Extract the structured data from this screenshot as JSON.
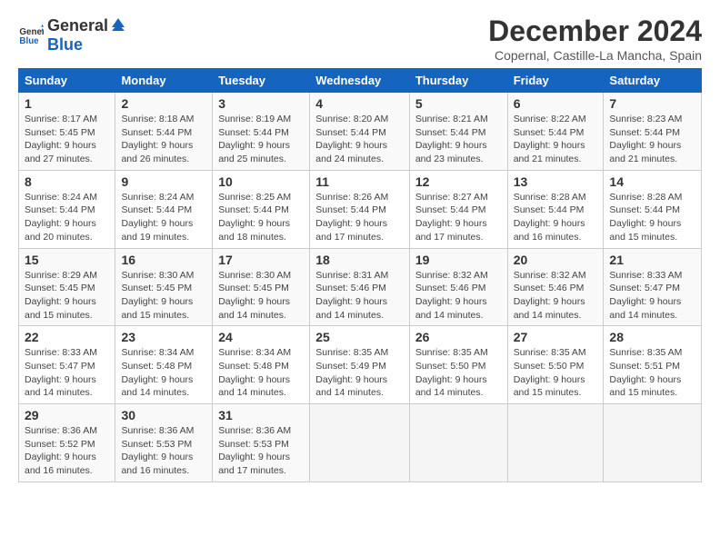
{
  "header": {
    "logo_general": "General",
    "logo_blue": "Blue",
    "title": "December 2024",
    "location": "Copernal, Castille-La Mancha, Spain"
  },
  "calendar": {
    "days_of_week": [
      "Sunday",
      "Monday",
      "Tuesday",
      "Wednesday",
      "Thursday",
      "Friday",
      "Saturday"
    ],
    "weeks": [
      [
        {
          "day": "",
          "info": ""
        },
        {
          "day": "2",
          "info": "Sunrise: 8:18 AM\nSunset: 5:44 PM\nDaylight: 9 hours\nand 26 minutes."
        },
        {
          "day": "3",
          "info": "Sunrise: 8:19 AM\nSunset: 5:44 PM\nDaylight: 9 hours\nand 25 minutes."
        },
        {
          "day": "4",
          "info": "Sunrise: 8:20 AM\nSunset: 5:44 PM\nDaylight: 9 hours\nand 24 minutes."
        },
        {
          "day": "5",
          "info": "Sunrise: 8:21 AM\nSunset: 5:44 PM\nDaylight: 9 hours\nand 23 minutes."
        },
        {
          "day": "6",
          "info": "Sunrise: 8:22 AM\nSunset: 5:44 PM\nDaylight: 9 hours\nand 21 minutes."
        },
        {
          "day": "7",
          "info": "Sunrise: 8:23 AM\nSunset: 5:44 PM\nDaylight: 9 hours\nand 21 minutes."
        }
      ],
      [
        {
          "day": "8",
          "info": "Sunrise: 8:24 AM\nSunset: 5:44 PM\nDaylight: 9 hours\nand 20 minutes."
        },
        {
          "day": "9",
          "info": "Sunrise: 8:24 AM\nSunset: 5:44 PM\nDaylight: 9 hours\nand 19 minutes."
        },
        {
          "day": "10",
          "info": "Sunrise: 8:25 AM\nSunset: 5:44 PM\nDaylight: 9 hours\nand 18 minutes."
        },
        {
          "day": "11",
          "info": "Sunrise: 8:26 AM\nSunset: 5:44 PM\nDaylight: 9 hours\nand 17 minutes."
        },
        {
          "day": "12",
          "info": "Sunrise: 8:27 AM\nSunset: 5:44 PM\nDaylight: 9 hours\nand 17 minutes."
        },
        {
          "day": "13",
          "info": "Sunrise: 8:28 AM\nSunset: 5:44 PM\nDaylight: 9 hours\nand 16 minutes."
        },
        {
          "day": "14",
          "info": "Sunrise: 8:28 AM\nSunset: 5:44 PM\nDaylight: 9 hours\nand 15 minutes."
        }
      ],
      [
        {
          "day": "15",
          "info": "Sunrise: 8:29 AM\nSunset: 5:45 PM\nDaylight: 9 hours\nand 15 minutes."
        },
        {
          "day": "16",
          "info": "Sunrise: 8:30 AM\nSunset: 5:45 PM\nDaylight: 9 hours\nand 15 minutes."
        },
        {
          "day": "17",
          "info": "Sunrise: 8:30 AM\nSunset: 5:45 PM\nDaylight: 9 hours\nand 14 minutes."
        },
        {
          "day": "18",
          "info": "Sunrise: 8:31 AM\nSunset: 5:46 PM\nDaylight: 9 hours\nand 14 minutes."
        },
        {
          "day": "19",
          "info": "Sunrise: 8:32 AM\nSunset: 5:46 PM\nDaylight: 9 hours\nand 14 minutes."
        },
        {
          "day": "20",
          "info": "Sunrise: 8:32 AM\nSunset: 5:46 PM\nDaylight: 9 hours\nand 14 minutes."
        },
        {
          "day": "21",
          "info": "Sunrise: 8:33 AM\nSunset: 5:47 PM\nDaylight: 9 hours\nand 14 minutes."
        }
      ],
      [
        {
          "day": "22",
          "info": "Sunrise: 8:33 AM\nSunset: 5:47 PM\nDaylight: 9 hours\nand 14 minutes."
        },
        {
          "day": "23",
          "info": "Sunrise: 8:34 AM\nSunset: 5:48 PM\nDaylight: 9 hours\nand 14 minutes."
        },
        {
          "day": "24",
          "info": "Sunrise: 8:34 AM\nSunset: 5:48 PM\nDaylight: 9 hours\nand 14 minutes."
        },
        {
          "day": "25",
          "info": "Sunrise: 8:35 AM\nSunset: 5:49 PM\nDaylight: 9 hours\nand 14 minutes."
        },
        {
          "day": "26",
          "info": "Sunrise: 8:35 AM\nSunset: 5:50 PM\nDaylight: 9 hours\nand 14 minutes."
        },
        {
          "day": "27",
          "info": "Sunrise: 8:35 AM\nSunset: 5:50 PM\nDaylight: 9 hours\nand 15 minutes."
        },
        {
          "day": "28",
          "info": "Sunrise: 8:35 AM\nSunset: 5:51 PM\nDaylight: 9 hours\nand 15 minutes."
        }
      ],
      [
        {
          "day": "29",
          "info": "Sunrise: 8:36 AM\nSunset: 5:52 PM\nDaylight: 9 hours\nand 16 minutes."
        },
        {
          "day": "30",
          "info": "Sunrise: 8:36 AM\nSunset: 5:53 PM\nDaylight: 9 hours\nand 16 minutes."
        },
        {
          "day": "31",
          "info": "Sunrise: 8:36 AM\nSunset: 5:53 PM\nDaylight: 9 hours\nand 17 minutes."
        },
        {
          "day": "",
          "info": ""
        },
        {
          "day": "",
          "info": ""
        },
        {
          "day": "",
          "info": ""
        },
        {
          "day": "",
          "info": ""
        }
      ]
    ],
    "first_week_sunday": {
      "day": "1",
      "info": "Sunrise: 8:17 AM\nSunset: 5:45 PM\nDaylight: 9 hours\nand 27 minutes."
    }
  }
}
